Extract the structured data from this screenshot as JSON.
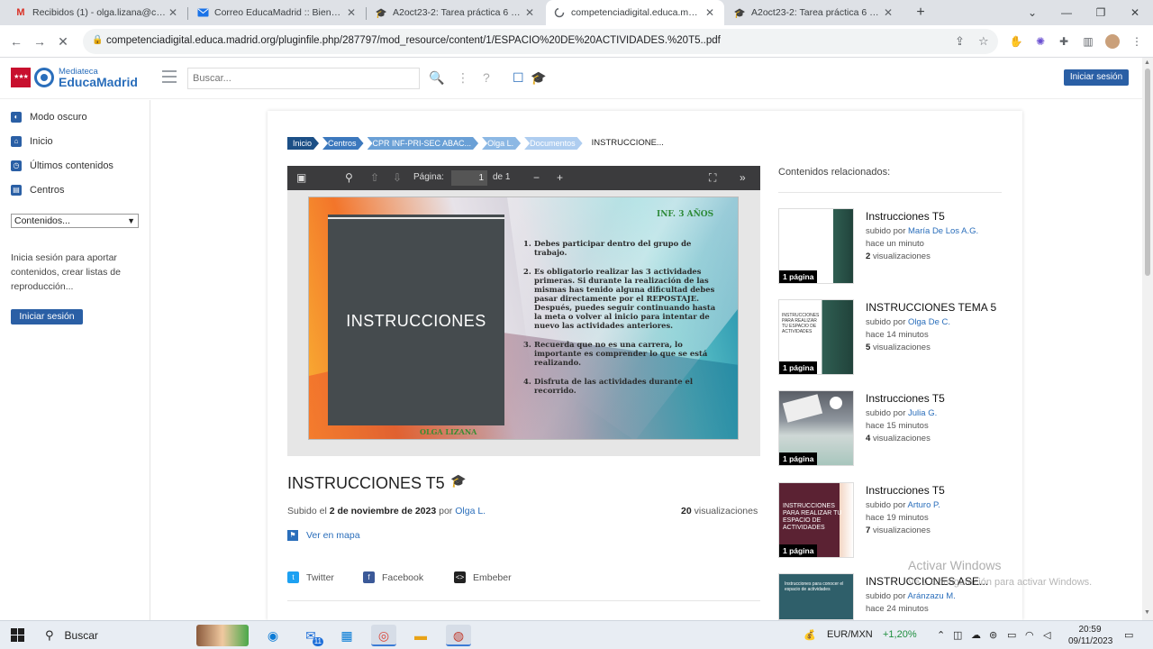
{
  "browser": {
    "tabs": [
      {
        "label": "Recibidos (1) - olga.lizana@cole...",
        "favicon": "gmail-icon",
        "color": "#d93025"
      },
      {
        "label": "Correo EducaMadrid :: Bienveni...",
        "favicon": "mail-icon",
        "color": "#1a73e8"
      },
      {
        "label": "A2oct23-2: Tarea práctica 6 - Ni...",
        "favicon": "graduation-cap-icon",
        "color": "#1a5fb4"
      },
      {
        "label": "competenciadigital.educa.madrid...",
        "favicon": "loading-icon",
        "color": "#5f6368"
      },
      {
        "label": "A2oct23-2: Tarea práctica 6 - Ni...",
        "favicon": "graduation-cap-icon",
        "color": "#1a5fb4"
      }
    ],
    "url": "competenciadigital.educa.madrid.org/pluginfile.php/287797/mod_resource/content/1/ESPACIO%20DE%20ACTIVIDADES.%20T5..pdf"
  },
  "header": {
    "logo_small": "Mediateca",
    "logo_big": "EducaMadrid",
    "search_placeholder": "Buscar...",
    "login_label": "Iniciar sesión"
  },
  "sidebar": {
    "items": [
      {
        "label": "Modo oscuro"
      },
      {
        "label": "Inicio"
      },
      {
        "label": "Últimos contenidos"
      },
      {
        "label": "Centros"
      }
    ],
    "select_value": "Contenidos...",
    "info_text": "Inicia sesión para aportar contenidos, crear listas de reproducción...",
    "login_label": "Iniciar sesión"
  },
  "breadcrumb": [
    "Inicio",
    "Centros",
    "CPR INF-PRI-SEC ABAC...",
    "Olga L.",
    "Documentos",
    "INSTRUCCIONE..."
  ],
  "viewer": {
    "page_label": "Página:",
    "page_current": "1",
    "page_total": "de 1"
  },
  "slide": {
    "tag": "INF. 3 AÑOS",
    "title": "INSTRUCCIONES",
    "items": [
      {
        "num": "1.",
        "text": "Debes participar dentro del grupo de trabajo."
      },
      {
        "num": "2.",
        "text": "Es obligatorio realizar las 3 actividades primeras. Si durante la realización de las mismas has tenido alguna dificultad debes pasar directamente por el REPOSTAJE. Después, puedes seguir continuando hasta la meta o volver al inicio para intentar de nuevo las actividades anteriores."
      },
      {
        "num": "3.",
        "text": "Recuerda que no es una carrera, lo importante es comprender lo que se está realizando."
      },
      {
        "num": "4.",
        "text": "Disfruta de las actividades durante el recorrido."
      }
    ],
    "author": "OLGA LIZANA"
  },
  "document": {
    "title": "INSTRUCCIONES T5",
    "uploaded_prefix": "Subido el",
    "uploaded_date": "2 de noviembre de 2023",
    "by": "por",
    "author": "Olga L.",
    "views_count": "20",
    "views_label": "visualizaciones",
    "map_link": "Ver en mapa",
    "share": [
      {
        "label": "Twitter",
        "icon": "twitter-icon",
        "color": "#1da1f2"
      },
      {
        "label": "Facebook",
        "icon": "facebook-icon",
        "color": "#3b5998"
      },
      {
        "label": "Embeber",
        "icon": "embed-icon",
        "color": "#222222"
      }
    ]
  },
  "related": {
    "heading": "Contenidos relacionados:",
    "items": [
      {
        "title": "Instrucciones T5",
        "uploaded_by": "subido por",
        "author": "María De Los A.G.",
        "time": "hace un minuto",
        "views": "2",
        "views_label": "visualizaciones",
        "pages": "1 página"
      },
      {
        "title": "INSTRUCCIONES TEMA 5",
        "uploaded_by": "subido por",
        "author": "Olga De C.",
        "time": "hace 14 minutos",
        "views": "5",
        "views_label": "visualizaciones",
        "pages": "1 página"
      },
      {
        "title": "Instrucciones T5",
        "uploaded_by": "subido por",
        "author": "Julia G.",
        "time": "hace 15 minutos",
        "views": "4",
        "views_label": "visualizaciones",
        "pages": "1 página"
      },
      {
        "title": "Instrucciones T5",
        "uploaded_by": "subido por",
        "author": "Arturo P.",
        "time": "hace 19 minutos",
        "views": "7",
        "views_label": "visualizaciones",
        "pages": "1 página"
      },
      {
        "title": "INSTRUCCIONES ASE...",
        "uploaded_by": "subido por",
        "author": "Aránzazu M.",
        "time": "hace 24 minutos",
        "views": "",
        "views_label": "",
        "pages": ""
      }
    ],
    "thumb_texts": {
      "second": "INSTRUCCIONES PARA REALIZAR TU ESPACIO DE ACTIVIDADES",
      "fourth": "INSTRUCCIONES PARA REALIZAR TU ESPACIO DE ACTIVIDADES",
      "fifth": "Instrucciones para conocer el espacio de actividades"
    }
  },
  "watermark": {
    "line1": "Activar Windows",
    "line2": "Ve a Configuración para activar Windows."
  },
  "taskbar": {
    "search_label": "Buscar",
    "currency": "EUR/MXN",
    "currency_change": "+1,20%",
    "time": "20:59",
    "date": "09/11/2023",
    "mail_badge": "11"
  }
}
